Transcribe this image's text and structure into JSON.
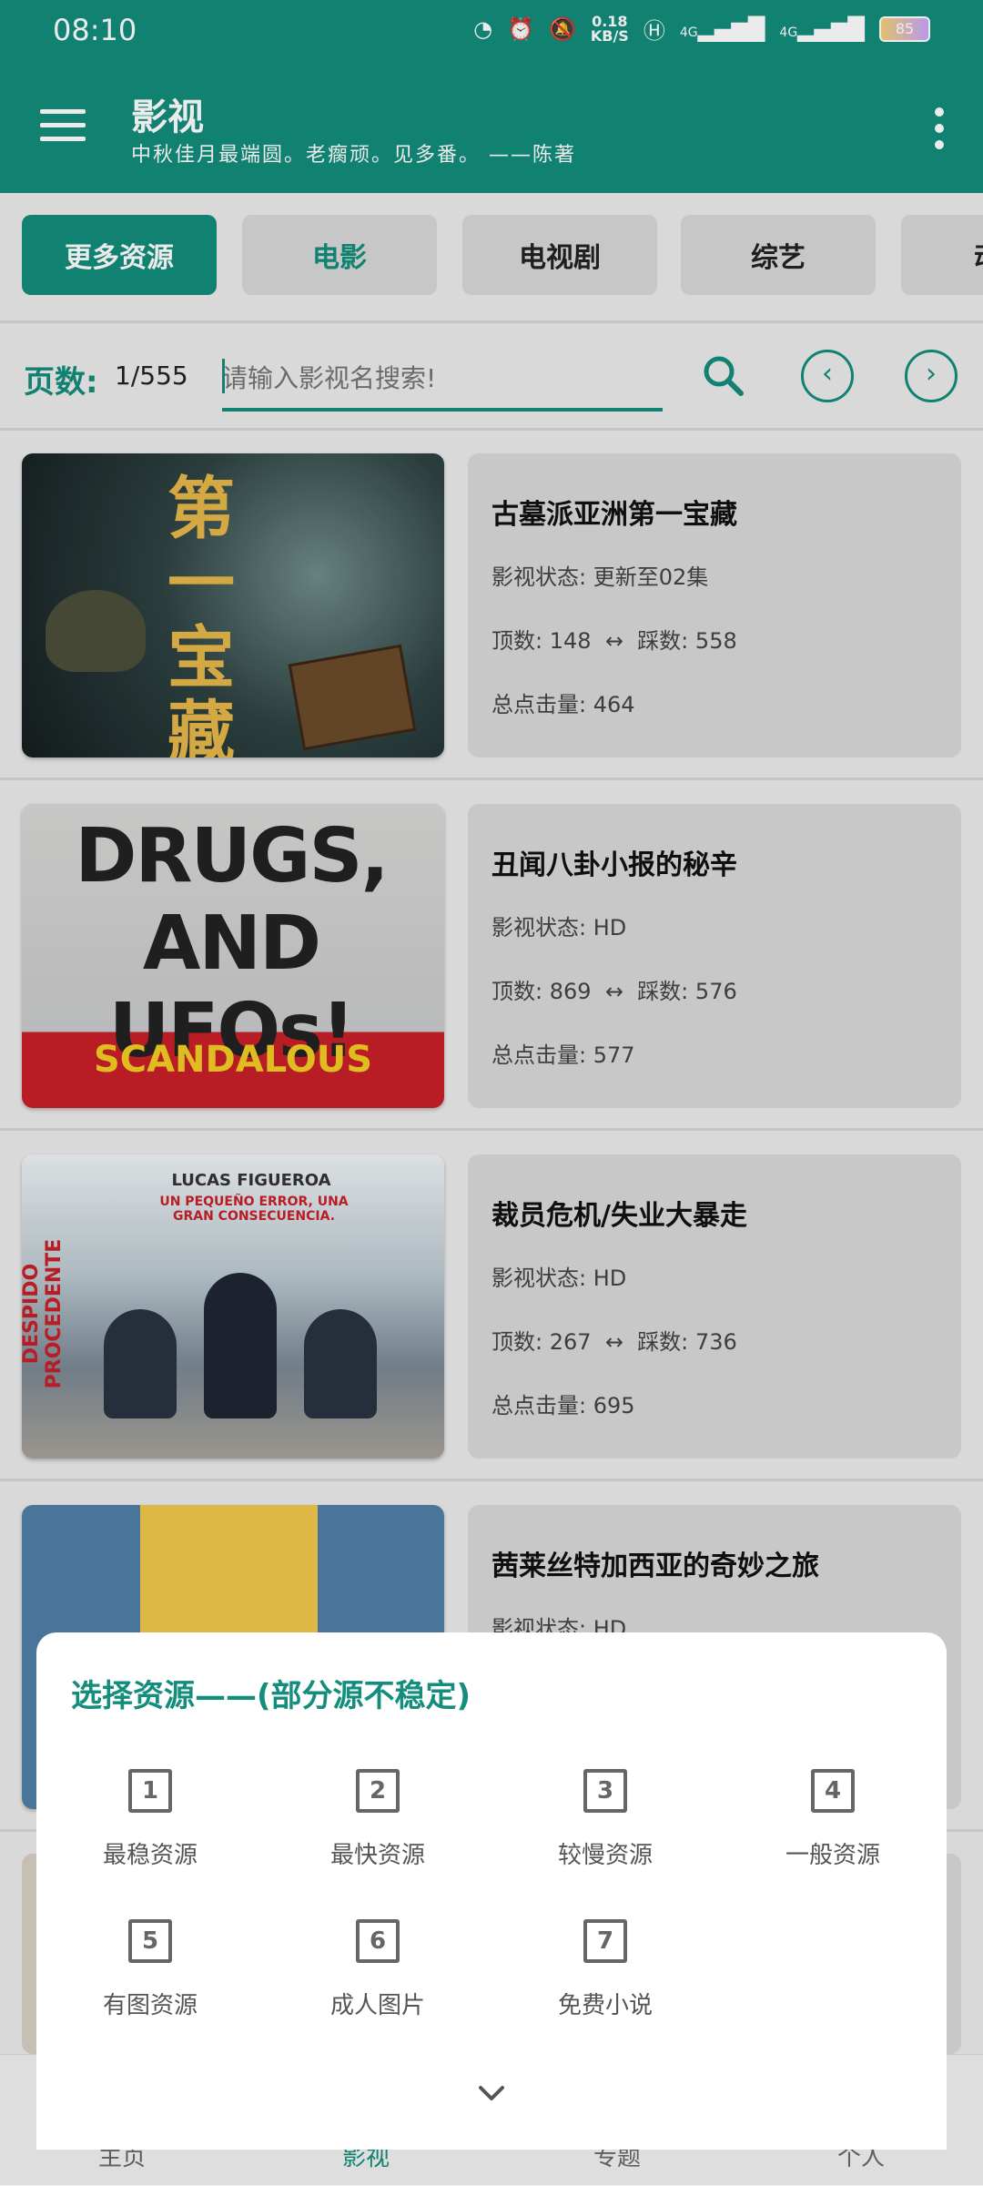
{
  "status": {
    "time": "08:10",
    "net_speed": "0.18",
    "net_unit": "KB/S",
    "signal1": "4G",
    "signal2": "4G",
    "battery": "85"
  },
  "appbar": {
    "title": "影视",
    "subtitle": "中秋佳月最端圆。老瘸顽。见多番。 ——陈著"
  },
  "tabs": [
    {
      "label": "更多资源"
    },
    {
      "label": "电影"
    },
    {
      "label": "电视剧"
    },
    {
      "label": "综艺"
    },
    {
      "label": "动"
    }
  ],
  "search": {
    "page_label": "页数:",
    "page_value": "1/555",
    "placeholder": "请输入影视名搜索!"
  },
  "items": [
    {
      "title": "古墓派亚洲第一宝藏",
      "status_label": "影视状态:",
      "status": "更新至02集",
      "up_label": "顶数:",
      "up": "148",
      "arrow": "↔",
      "down_label": "踩数:",
      "down": "558",
      "clicks_label": "总点击量:",
      "clicks": "464",
      "poster_text": "第一宝藏"
    },
    {
      "title": "丑闻八卦小报的秘辛",
      "status_label": "影视状态:",
      "status": "HD",
      "up_label": "顶数:",
      "up": "869",
      "arrow": "↔",
      "down_label": "踩数:",
      "down": "576",
      "clicks_label": "总点击量:",
      "clicks": "577",
      "poster_text": "DRUGS, AND UFOs!",
      "poster_banner": "SCANDALOUS"
    },
    {
      "title": "裁员危机/失业大暴走",
      "status_label": "影视状态:",
      "status": "HD",
      "up_label": "顶数:",
      "up": "267",
      "arrow": "↔",
      "down_label": "踩数:",
      "down": "736",
      "clicks_label": "总点击量:",
      "clicks": "695",
      "poster_text": "DESPIDO PROCEDENTE",
      "poster_top": "LUCAS FIGUEROA",
      "poster_tagline": "UN PEQUEÑO ERROR, UNA GRAN CONSECUENCIA."
    },
    {
      "title": "茜莱丝特加西亚的奇妙之旅",
      "status_label": "影视状态:",
      "status": "HD"
    }
  ],
  "bottom_nav": [
    {
      "label": "主页"
    },
    {
      "label": "影视"
    },
    {
      "label": "专题"
    },
    {
      "label": "个人"
    }
  ],
  "sheet": {
    "title": "选择资源——(部分源不稳定)",
    "options": [
      {
        "num": "1",
        "label": "最稳资源"
      },
      {
        "num": "2",
        "label": "最快资源"
      },
      {
        "num": "3",
        "label": "较慢资源"
      },
      {
        "num": "4",
        "label": "一般资源"
      },
      {
        "num": "5",
        "label": "有图资源"
      },
      {
        "num": "6",
        "label": "成人图片"
      },
      {
        "num": "7",
        "label": "免费小说"
      }
    ]
  },
  "colors": {
    "primary": "#138d7c",
    "card_bg": "#d9d9d9",
    "page_bg": "#ececec"
  }
}
